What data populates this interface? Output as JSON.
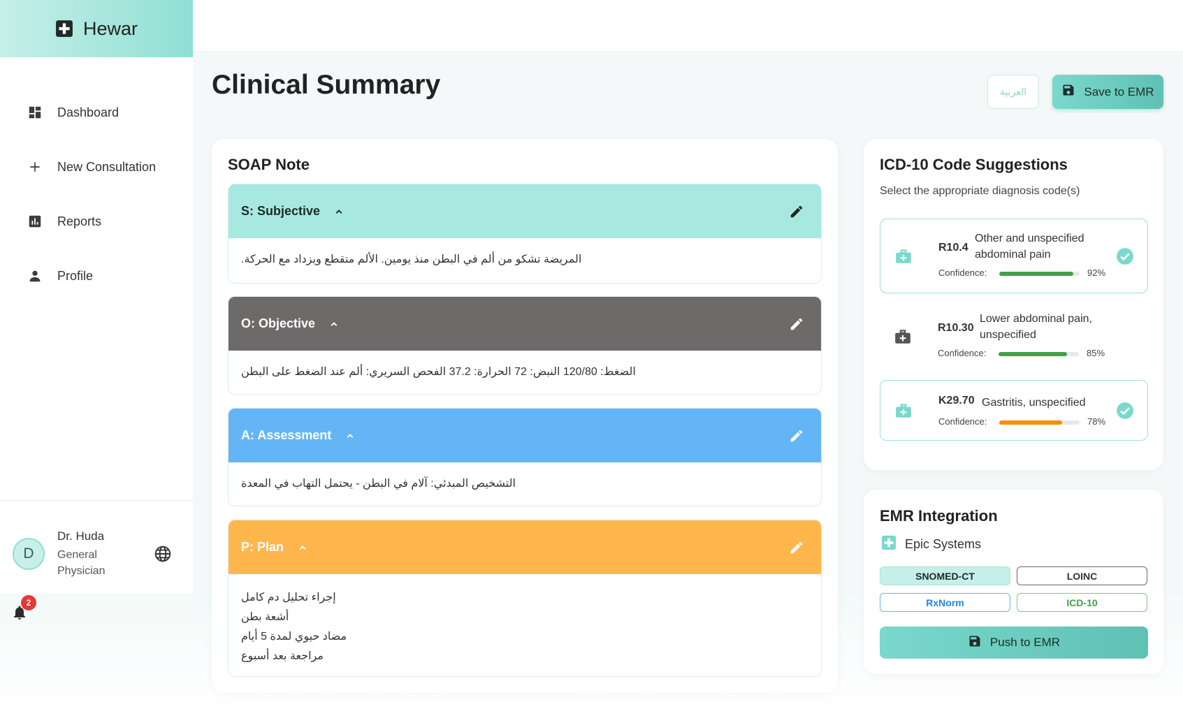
{
  "brand": {
    "name": "Hewar"
  },
  "sidebar": {
    "items": [
      {
        "label": "Dashboard",
        "icon": "dashboard-icon"
      },
      {
        "label": "New Consultation",
        "icon": "plus-icon"
      },
      {
        "label": "Reports",
        "icon": "bar-chart-icon"
      },
      {
        "label": "Profile",
        "icon": "person-icon"
      }
    ]
  },
  "user": {
    "initial": "D",
    "name": "Dr. Huda",
    "role_line1": "General",
    "role_line2": "Physician",
    "notifications": "2"
  },
  "header": {
    "title": "Clinical Summary",
    "lang_label": "العربية",
    "save_label": "Save to EMR"
  },
  "soap": {
    "title": "SOAP Note",
    "sections": [
      {
        "title": "S: Subjective",
        "color": "#a7e9e0",
        "lines": [
          "المريضة تشكو من ألم في البطن منذ يومين. الألم متقطع ويزداد مع الحركة."
        ]
      },
      {
        "title": "O: Objective",
        "color": "#6d6a6a",
        "lines": [
          "الضغط: 120/80 النبض: 72 الحرارة: 37.2 الفحص السريري: ألم عند الضغط على البطن"
        ]
      },
      {
        "title": "A: Assessment",
        "color": "#64b5f6",
        "lines": [
          "التشخيص المبدئي: آلام في البطن - يحتمل التهاب في المعدة"
        ]
      },
      {
        "title": "P: Plan",
        "color": "#ffb74d",
        "lines": [
          "إجراء تحليل دم كامل",
          "أشعة بطن",
          "مضاد حيوي لمدة 5 أيام",
          "مراجعة بعد أسبوع"
        ]
      }
    ]
  },
  "icd": {
    "title": "ICD-10 Code Suggestions",
    "subtitle": "Select the appropriate diagnosis code(s)",
    "confidence_label": "Confidence:",
    "items": [
      {
        "code": "R10.4",
        "desc": "Other and unspecified abdominal pain",
        "confidence": 92,
        "confidence_text": "92%",
        "selected": true,
        "bar_color": "#43a047"
      },
      {
        "code": "R10.30",
        "desc": "Lower abdominal pain, unspecified",
        "confidence": 85,
        "confidence_text": "85%",
        "selected": false,
        "bar_color": "#43a047"
      },
      {
        "code": "K29.70",
        "desc": "Gastritis, unspecified",
        "confidence": 78,
        "confidence_text": "78%",
        "selected": true,
        "bar_color": "#fb8c00"
      }
    ]
  },
  "emr": {
    "title": "EMR Integration",
    "system": "Epic Systems",
    "chips": [
      {
        "label": "SNOMED-CT"
      },
      {
        "label": "LOINC"
      },
      {
        "label": "RxNorm"
      },
      {
        "label": "ICD-10"
      }
    ],
    "push_label": "Push to EMR"
  }
}
